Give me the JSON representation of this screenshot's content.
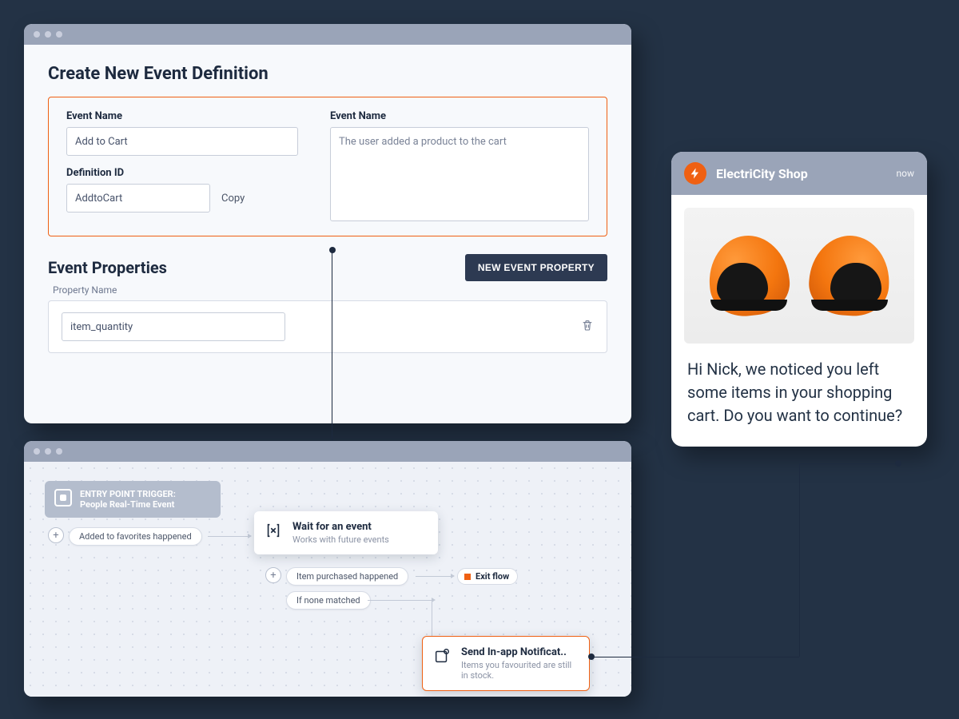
{
  "top": {
    "title": "Create New Event Definition",
    "event_name_label": "Event Name",
    "event_name_value": "Add to Cart",
    "description_label": "Event Name",
    "description_value": "The user added a product to the cart",
    "definition_id_label": "Definition ID",
    "definition_id_value": "AddtoCart",
    "copy_label": "Copy",
    "properties_title": "Event Properties",
    "new_property_button": "NEW EVENT PROPERTY",
    "property_sublabel": "Property Name",
    "property_value": "item_quantity"
  },
  "flow": {
    "entry_title1": "ENTRY POINT TRIGGER:",
    "entry_title2": "People Real-Time Event",
    "pill_added_fav": "Added to favorites happened",
    "wait_title": "Wait for an event",
    "wait_sub": "Works with future events",
    "pill_item_purchased": "Item purchased happened",
    "pill_none": "If none matched",
    "exit_label": "Exit flow",
    "send_title": "Send In-app Notificat..",
    "send_sub": "Items you favourited are still in stock."
  },
  "push": {
    "app_name": "ElectriCity Shop",
    "timestamp": "now",
    "message": "Hi Nick, we noticed you left some items in your shopping cart. Do you want to continue?"
  },
  "colors": {
    "accent": "#ef6012",
    "dark": "#2d3a52"
  }
}
